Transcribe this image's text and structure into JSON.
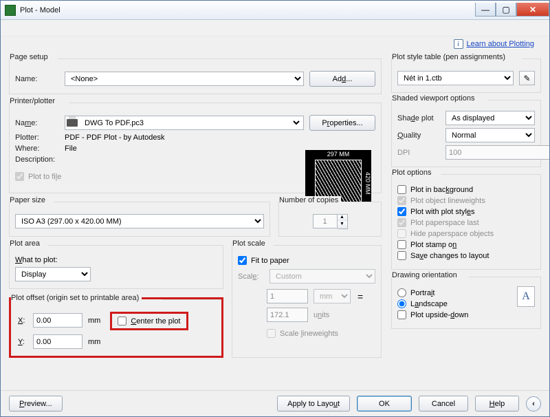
{
  "window": {
    "title": "Plot - Model"
  },
  "learn": {
    "text": "Learn about Plotting"
  },
  "pageSetup": {
    "legend": "Page setup",
    "nameLabel": "Name:",
    "name": "<None>",
    "addBtn": "Add..."
  },
  "printer": {
    "legend": "Printer/plotter",
    "nameLabel": "Name:",
    "name": "DWG To PDF.pc3",
    "propsBtn": "Properties...",
    "plotterLabel": "Plotter:",
    "plotter": "PDF - PDF Plot - by Autodesk",
    "whereLabel": "Where:",
    "where": "File",
    "descLabel": "Description:",
    "plotToFile": "Plot to file",
    "preview": {
      "w": "297 MM",
      "h": "420 MM"
    }
  },
  "paper": {
    "legend": "Paper size",
    "value": "ISO A3 (297.00 x 420.00 MM)",
    "copiesLegend": "Number of copies",
    "copies": "1"
  },
  "area": {
    "legend": "Plot area",
    "whatLabel": "What to plot:",
    "what": "Display"
  },
  "offset": {
    "legend": "Plot offset (origin set to printable area)",
    "xLabel": "X:",
    "x": "0.00",
    "yLabel": "Y:",
    "y": "0.00",
    "unit": "mm",
    "center": "Center the plot"
  },
  "scale": {
    "legend": "Plot scale",
    "fit": "Fit to paper",
    "scaleLabel": "Scale:",
    "scaleValue": "Custom",
    "num": "1",
    "numUnit": "mm",
    "den": "172.1",
    "denUnit": "units",
    "lineweights": "Scale lineweights"
  },
  "style": {
    "legend": "Plot style table (pen assignments)",
    "value": "Nét in  1.ctb"
  },
  "shaded": {
    "legend": "Shaded viewport options",
    "shadeLabel": "Shade plot",
    "shade": "As displayed",
    "qualityLabel": "Quality",
    "quality": "Normal",
    "dpiLabel": "DPI",
    "dpi": "100"
  },
  "options": {
    "legend": "Plot options",
    "bg": "Plot in background",
    "lw": "Plot object lineweights",
    "styles": "Plot with plot styles",
    "paperspace": "Plot paperspace last",
    "hide": "Hide paperspace objects",
    "stamp": "Plot stamp on",
    "save": "Save changes to layout"
  },
  "orient": {
    "legend": "Drawing orientation",
    "portrait": "Portrait",
    "landscape": "Landscape",
    "upside": "Plot upside-down"
  },
  "footer": {
    "preview": "Preview...",
    "apply": "Apply to Layout",
    "ok": "OK",
    "cancel": "Cancel",
    "help": "Help"
  }
}
